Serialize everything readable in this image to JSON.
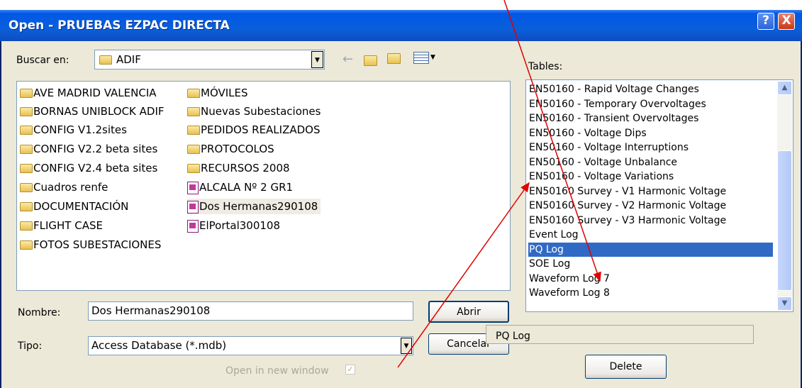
{
  "window": {
    "title": "Open - PRUEBAS EZPAC DIRECTA",
    "help_label": "?",
    "close_label": "X"
  },
  "look_in": {
    "label": "Buscar en:",
    "value": "ADIF"
  },
  "tables": {
    "label": "Tables:",
    "items": [
      "EN50160 - Rapid Voltage Changes",
      "EN50160 - Temporary Overvoltages",
      "EN50160 - Transient Overvoltages",
      "EN50160 - Voltage Dips",
      "EN50160 - Voltage Interruptions",
      "EN50160 - Voltage Unbalance",
      "EN50160 - Voltage Variations",
      "EN50160 Survey - V1 Harmonic Voltage",
      "EN50160 Survey - V2 Harmonic Voltage",
      "EN50160 Survey - V3 Harmonic Voltage",
      "Event Log",
      "PQ Log",
      "SOE Log",
      "Waveform Log 7",
      "Waveform Log 8"
    ],
    "selected": "PQ Log"
  },
  "files": {
    "col1": [
      "AVE MADRID VALENCIA",
      "BORNAS UNIBLOCK ADIF",
      "CONFIG V1.2sites",
      "CONFIG V2.2 beta sites",
      "CONFIG V2.4 beta sites",
      "Cuadros renfe",
      "DOCUMENTACIÓN",
      "FLIGHT CASE",
      "FOTOS SUBESTACIONES"
    ],
    "col2_folders": [
      "MÓVILES",
      "Nuevas Subestaciones",
      "PEDIDOS REALIZADOS",
      "PROTOCOLOS",
      "RECURSOS 2008"
    ],
    "col2_files": [
      "ALCALA Nº 2 GR1",
      "Dos Hermanas290108",
      "ElPortal300108"
    ],
    "selected": "Dos Hermanas290108"
  },
  "filename": {
    "label": "Nombre:",
    "value": "Dos Hermanas290108"
  },
  "filetype": {
    "label": "Tipo:",
    "value": "Access Database (*.mdb)"
  },
  "buttons": {
    "open": "Abrir",
    "cancel": "Cancelar",
    "delete": "Delete"
  },
  "selected_table_display": "PQ Log",
  "open_new_window": {
    "label": "Open in new window",
    "checked": true
  },
  "colors": {
    "titlebar": "#0A5FDB",
    "dialog_bg": "#ECE9D8",
    "selection": "#316AC5",
    "annotation": "#E00000"
  },
  "icons": [
    "back-arrow-icon",
    "up-folder-icon",
    "new-folder-icon",
    "view-menu-icon",
    "folder-icon",
    "access-db-icon"
  ]
}
